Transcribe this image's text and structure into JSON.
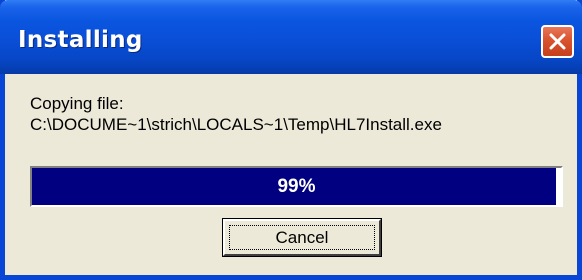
{
  "window": {
    "title": "Installing",
    "close_icon": "close-x-icon"
  },
  "message": {
    "line1": "Copying file:",
    "line2": "C:\\DOCUME~1\\strich\\LOCALS~1\\Temp\\HL7Install.exe"
  },
  "progress": {
    "value": 0.99,
    "label": "99%"
  },
  "buttons": {
    "cancel_label": "Cancel"
  },
  "colors": {
    "titlebar": "#0a55df",
    "progress_fill": "#000080",
    "dialog_bg": "#ece9d8",
    "close_button": "#d9532f"
  }
}
